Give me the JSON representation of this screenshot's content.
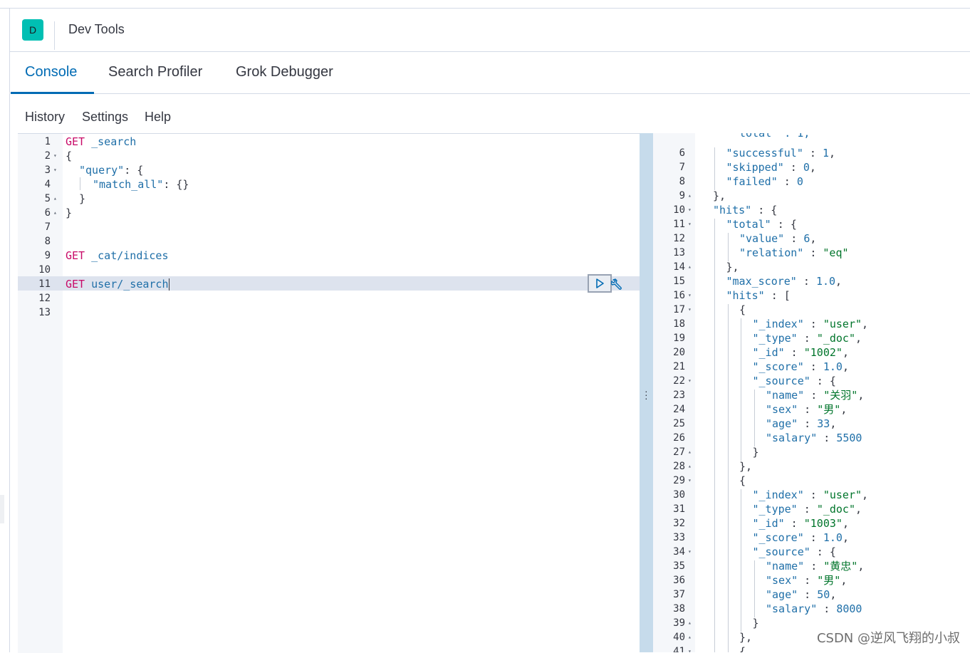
{
  "app": {
    "avatar_letter": "D",
    "title": "Dev Tools"
  },
  "tabs": [
    {
      "label": "Console",
      "active": true
    },
    {
      "label": "Search Profiler",
      "active": false
    },
    {
      "label": "Grok Debugger",
      "active": false
    }
  ],
  "subnav": {
    "history": "History",
    "settings": "Settings",
    "help": "Help"
  },
  "request_editor": {
    "lines": [
      {
        "n": "1",
        "fold": ""
      },
      {
        "n": "2",
        "fold": "▾"
      },
      {
        "n": "3",
        "fold": "▾"
      },
      {
        "n": "4",
        "fold": ""
      },
      {
        "n": "5",
        "fold": "▴"
      },
      {
        "n": "6",
        "fold": "▴"
      },
      {
        "n": "7",
        "fold": ""
      },
      {
        "n": "8",
        "fold": ""
      },
      {
        "n": "9",
        "fold": ""
      },
      {
        "n": "10",
        "fold": ""
      },
      {
        "n": "11",
        "fold": ""
      },
      {
        "n": "12",
        "fold": ""
      },
      {
        "n": "13",
        "fold": ""
      }
    ],
    "req1_method": "GET",
    "req1_path": "_search",
    "open_brace": "{",
    "query_key": "\"query\"",
    "colon_brace": ": {",
    "match_all_key": "\"match_all\"",
    "match_all_val": ": {}",
    "close_inner": "}",
    "close_outer": "}",
    "req2_method": "GET",
    "req2_path": "_cat/indices",
    "req3_method": "GET",
    "req3_path": "user/_search",
    "active_line": "11"
  },
  "response_editor": {
    "partial_top": "\"total\" : 1,",
    "lines": [
      {
        "n": "6",
        "fold": "",
        "indent": 2,
        "key": "\"successful\"",
        "sep": " : ",
        "val": "1",
        "vt": "num",
        "tail": ","
      },
      {
        "n": "7",
        "fold": "",
        "indent": 2,
        "key": "\"skipped\"",
        "sep": " : ",
        "val": "0",
        "vt": "num",
        "tail": ","
      },
      {
        "n": "8",
        "fold": "",
        "indent": 2,
        "key": "\"failed\"",
        "sep": " : ",
        "val": "0",
        "vt": "num",
        "tail": ""
      },
      {
        "n": "9",
        "fold": "▴",
        "indent": 1,
        "key": "",
        "sep": "",
        "val": "",
        "vt": "",
        "tail": "},"
      },
      {
        "n": "10",
        "fold": "▾",
        "indent": 1,
        "key": "\"hits\"",
        "sep": " : ",
        "val": "",
        "vt": "",
        "tail": "{"
      },
      {
        "n": "11",
        "fold": "▾",
        "indent": 2,
        "key": "\"total\"",
        "sep": " : ",
        "val": "",
        "vt": "",
        "tail": "{"
      },
      {
        "n": "12",
        "fold": "",
        "indent": 3,
        "key": "\"value\"",
        "sep": " : ",
        "val": "6",
        "vt": "num",
        "tail": ","
      },
      {
        "n": "13",
        "fold": "",
        "indent": 3,
        "key": "\"relation\"",
        "sep": " : ",
        "val": "\"eq\"",
        "vt": "str",
        "tail": ""
      },
      {
        "n": "14",
        "fold": "▴",
        "indent": 2,
        "key": "",
        "sep": "",
        "val": "",
        "vt": "",
        "tail": "},"
      },
      {
        "n": "15",
        "fold": "",
        "indent": 2,
        "key": "\"max_score\"",
        "sep": " : ",
        "val": "1.0",
        "vt": "num",
        "tail": ","
      },
      {
        "n": "16",
        "fold": "▾",
        "indent": 2,
        "key": "\"hits\"",
        "sep": " : ",
        "val": "",
        "vt": "",
        "tail": "["
      },
      {
        "n": "17",
        "fold": "▾",
        "indent": 3,
        "key": "",
        "sep": "",
        "val": "",
        "vt": "",
        "tail": "{"
      },
      {
        "n": "18",
        "fold": "",
        "indent": 4,
        "key": "\"_index\"",
        "sep": " : ",
        "val": "\"user\"",
        "vt": "str",
        "tail": ","
      },
      {
        "n": "19",
        "fold": "",
        "indent": 4,
        "key": "\"_type\"",
        "sep": " : ",
        "val": "\"_doc\"",
        "vt": "str",
        "tail": ","
      },
      {
        "n": "20",
        "fold": "",
        "indent": 4,
        "key": "\"_id\"",
        "sep": " : ",
        "val": "\"1002\"",
        "vt": "str",
        "tail": ","
      },
      {
        "n": "21",
        "fold": "",
        "indent": 4,
        "key": "\"_score\"",
        "sep": " : ",
        "val": "1.0",
        "vt": "num",
        "tail": ","
      },
      {
        "n": "22",
        "fold": "▾",
        "indent": 4,
        "key": "\"_source\"",
        "sep": " : ",
        "val": "",
        "vt": "",
        "tail": "{"
      },
      {
        "n": "23",
        "fold": "",
        "indent": 5,
        "key": "\"name\"",
        "sep": " : ",
        "val": "\"关羽\"",
        "vt": "str",
        "tail": ","
      },
      {
        "n": "24",
        "fold": "",
        "indent": 5,
        "key": "\"sex\"",
        "sep": " : ",
        "val": "\"男\"",
        "vt": "str",
        "tail": ","
      },
      {
        "n": "25",
        "fold": "",
        "indent": 5,
        "key": "\"age\"",
        "sep": " : ",
        "val": "33",
        "vt": "num",
        "tail": ","
      },
      {
        "n": "26",
        "fold": "",
        "indent": 5,
        "key": "\"salary\"",
        "sep": " : ",
        "val": "5500",
        "vt": "num",
        "tail": ""
      },
      {
        "n": "27",
        "fold": "▴",
        "indent": 4,
        "key": "",
        "sep": "",
        "val": "",
        "vt": "",
        "tail": "}"
      },
      {
        "n": "28",
        "fold": "▴",
        "indent": 3,
        "key": "",
        "sep": "",
        "val": "",
        "vt": "",
        "tail": "},"
      },
      {
        "n": "29",
        "fold": "▾",
        "indent": 3,
        "key": "",
        "sep": "",
        "val": "",
        "vt": "",
        "tail": "{"
      },
      {
        "n": "30",
        "fold": "",
        "indent": 4,
        "key": "\"_index\"",
        "sep": " : ",
        "val": "\"user\"",
        "vt": "str",
        "tail": ","
      },
      {
        "n": "31",
        "fold": "",
        "indent": 4,
        "key": "\"_type\"",
        "sep": " : ",
        "val": "\"_doc\"",
        "vt": "str",
        "tail": ","
      },
      {
        "n": "32",
        "fold": "",
        "indent": 4,
        "key": "\"_id\"",
        "sep": " : ",
        "val": "\"1003\"",
        "vt": "str",
        "tail": ","
      },
      {
        "n": "33",
        "fold": "",
        "indent": 4,
        "key": "\"_score\"",
        "sep": " : ",
        "val": "1.0",
        "vt": "num",
        "tail": ","
      },
      {
        "n": "34",
        "fold": "▾",
        "indent": 4,
        "key": "\"_source\"",
        "sep": " : ",
        "val": "",
        "vt": "",
        "tail": "{"
      },
      {
        "n": "35",
        "fold": "",
        "indent": 5,
        "key": "\"name\"",
        "sep": " : ",
        "val": "\"黄忠\"",
        "vt": "str",
        "tail": ","
      },
      {
        "n": "36",
        "fold": "",
        "indent": 5,
        "key": "\"sex\"",
        "sep": " : ",
        "val": "\"男\"",
        "vt": "str",
        "tail": ","
      },
      {
        "n": "37",
        "fold": "",
        "indent": 5,
        "key": "\"age\"",
        "sep": " : ",
        "val": "50",
        "vt": "num",
        "tail": ","
      },
      {
        "n": "38",
        "fold": "",
        "indent": 5,
        "key": "\"salary\"",
        "sep": " : ",
        "val": "8000",
        "vt": "num",
        "tail": ""
      },
      {
        "n": "39",
        "fold": "▴",
        "indent": 4,
        "key": "",
        "sep": "",
        "val": "",
        "vt": "",
        "tail": "}"
      },
      {
        "n": "40",
        "fold": "▴",
        "indent": 3,
        "key": "",
        "sep": "",
        "val": "",
        "vt": "",
        "tail": "},"
      },
      {
        "n": "41",
        "fold": "▾",
        "indent": 3,
        "key": "",
        "sep": "",
        "val": "",
        "vt": "",
        "tail": "{"
      }
    ]
  },
  "watermark": "CSDN @逆风飞翔的小叔",
  "colors": {
    "accent": "#006bb4",
    "keyword": "#c80a68",
    "string": "#00752b",
    "key": "#1f6fa8"
  }
}
